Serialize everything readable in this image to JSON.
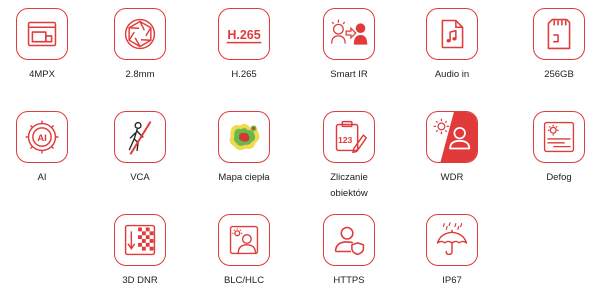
{
  "theme": {
    "accent": "#e03a3a",
    "text": "#222222",
    "heatmap_colors": [
      "#f0d94a",
      "#67b84f",
      "#cf3b2e"
    ]
  },
  "features": [
    {
      "key": "4mpx",
      "label": "4MPX",
      "icon": "resolution-icon"
    },
    {
      "key": "lens",
      "label": "2.8mm",
      "icon": "lens-aperture-icon"
    },
    {
      "key": "h265",
      "label": "H.265",
      "icon": "h265-codec-icon",
      "icon_text": "H.265"
    },
    {
      "key": "smartir",
      "label": "Smart IR",
      "icon": "smart-ir-icon"
    },
    {
      "key": "audio",
      "label": "Audio in",
      "icon": "audio-file-icon"
    },
    {
      "key": "storage",
      "label": "256GB",
      "icon": "sd-card-icon"
    },
    {
      "key": "ai",
      "label": "AI",
      "icon": "ai-chip-icon",
      "icon_text": "AI"
    },
    {
      "key": "vca",
      "label": "VCA",
      "icon": "vca-person-crossing-icon"
    },
    {
      "key": "heatmap",
      "label": "Mapa ciepła",
      "icon": "heatmap-icon"
    },
    {
      "key": "counting",
      "label": "Zliczanie obiektów",
      "label_lines": [
        "Zliczanie",
        "obiektów"
      ],
      "icon": "object-counting-icon",
      "icon_text": "123"
    },
    {
      "key": "wdr",
      "label": "WDR",
      "icon": "wdr-icon"
    },
    {
      "key": "defog",
      "label": "Defog",
      "icon": "defog-icon"
    },
    {
      "key": "dnr",
      "label": "3D DNR",
      "icon": "3d-dnr-icon"
    },
    {
      "key": "blc",
      "label": "BLC/HLC",
      "icon": "blc-hlc-icon"
    },
    {
      "key": "https",
      "label": "HTTPS",
      "icon": "https-user-shield-icon"
    },
    {
      "key": "ip67",
      "label": "IP67",
      "icon": "ip67-umbrella-rain-icon"
    }
  ]
}
